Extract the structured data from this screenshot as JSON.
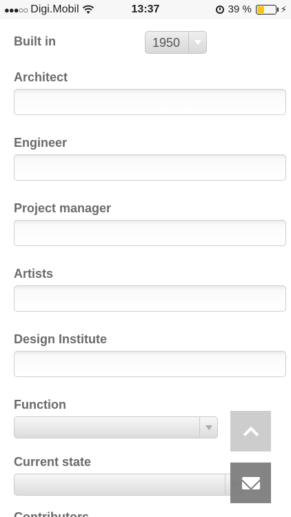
{
  "status_bar": {
    "signal": "●●●○○",
    "carrier": "Digi.Mobil",
    "time": "13:37",
    "battery": "39 %",
    "battery_level": 0.39
  },
  "form": {
    "built_in": {
      "label": "Built in",
      "value": "1950"
    },
    "architect": {
      "label": "Architect",
      "value": ""
    },
    "engineer": {
      "label": "Engineer",
      "value": ""
    },
    "project_manager": {
      "label": "Project manager",
      "value": ""
    },
    "artists": {
      "label": "Artists",
      "value": ""
    },
    "design_institute": {
      "label": "Design Institute",
      "value": ""
    },
    "function": {
      "label": "Function",
      "value": ""
    },
    "current_state": {
      "label": "Current state",
      "value": ""
    },
    "next_label": "Contributors"
  },
  "buttons": {
    "scroll_top_icon": "chevron-up-icon",
    "contact_icon": "envelope-icon"
  }
}
